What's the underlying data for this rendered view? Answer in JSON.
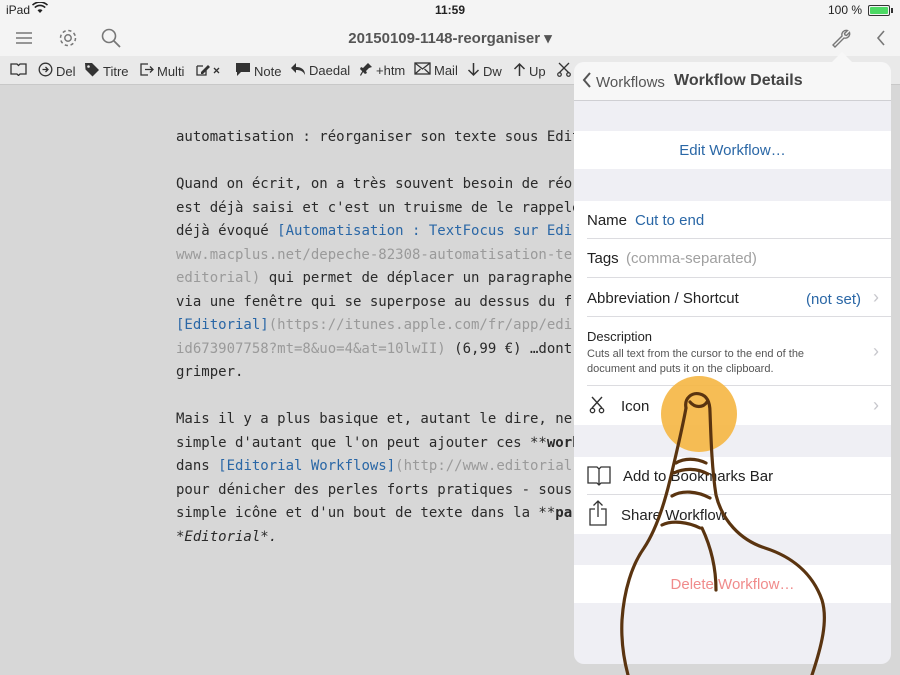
{
  "status_bar": {
    "carrier": "iPad",
    "time": "11:59",
    "battery": "100 %"
  },
  "navbar": {
    "title": "20150109-1148-reorganiser ▾"
  },
  "toolbar": {
    "items": [
      {
        "label": ""
      },
      {
        "label": "Del"
      },
      {
        "label": "Titre"
      },
      {
        "label": "Multi"
      },
      {
        "label": ""
      },
      {
        "label": "Note"
      },
      {
        "label": "Daedal"
      },
      {
        "label": "+htm"
      },
      {
        "label": "Mail"
      },
      {
        "label": "Dw"
      },
      {
        "label": "Up"
      }
    ]
  },
  "editor": {
    "line1": "automatisation : réorganiser son texte sous Edit",
    "p2_l1": "Quand on écrit, on a très souvent besoin de réo",
    "p2_l2": "est déjà saisi et c'est un truisme de le rappele",
    "p2_l3a": "déjà évoqué ",
    "p2_l3b": "[Automatisation : TextFocus sur Edi",
    "p2_l4": "www.macplus.net/depeche-82308-automatisation-te",
    "p2_l5a": "editorial)",
    "p2_l5b": " qui permet de déplacer un paragraphe",
    "p2_l6": "via une fenêtre qui se superpose au dessus du f",
    "p2_l7a": "[Editorial]",
    "p2_l7b": "(https://itunes.apple.com/fr/app/edi",
    "p2_l8a": "id673907758?mt=8&uo=4&at=10lwII)",
    "p2_l8b": " (6,99 €) …dont",
    "p2_l9": "grimper.",
    "p3_l1a": "Mais il y a plus basique et, autant le dire, ne",
    "p3_l2a": "simple d'autant que l'on peut ajouter ces **",
    "p3_l2b": "work",
    "p3_l3a": "dans ",
    "p3_l3b": "[Editorial Workflows]",
    "p3_l3c": "(http://www.editorial",
    "p3_l4": "pour dénicher des perles forts pratiques - sous",
    "p3_l5a": "simple icône et d'un bout de texte dans la **",
    "p3_l5b": "pa",
    "p3_l6": "*Editorial*."
  },
  "popover": {
    "back_label": "Workflows",
    "title": "Workflow Details",
    "edit_workflow": "Edit Workflow…",
    "name_label": "Name",
    "name_value": "Cut to end",
    "tags_label": "Tags",
    "tags_placeholder": "(comma-separated)",
    "abbrev_label": "Abbreviation / Shortcut",
    "abbrev_value": "(not set)",
    "desc_label": "Description",
    "desc_line1": "Cuts all text from the cursor to the end of the",
    "desc_line2": "document and puts it on the clipboard.",
    "icon_label": "Icon",
    "add_bookmarks": "Add to Bookmarks Bar",
    "share_workflow": "Share Workflow",
    "delete_workflow": "Delete Workflow…"
  },
  "colors": {
    "accent": "#2a67a6",
    "delete": "#f08b8b",
    "touch": "#f5b642",
    "battery": "#4cd964"
  }
}
